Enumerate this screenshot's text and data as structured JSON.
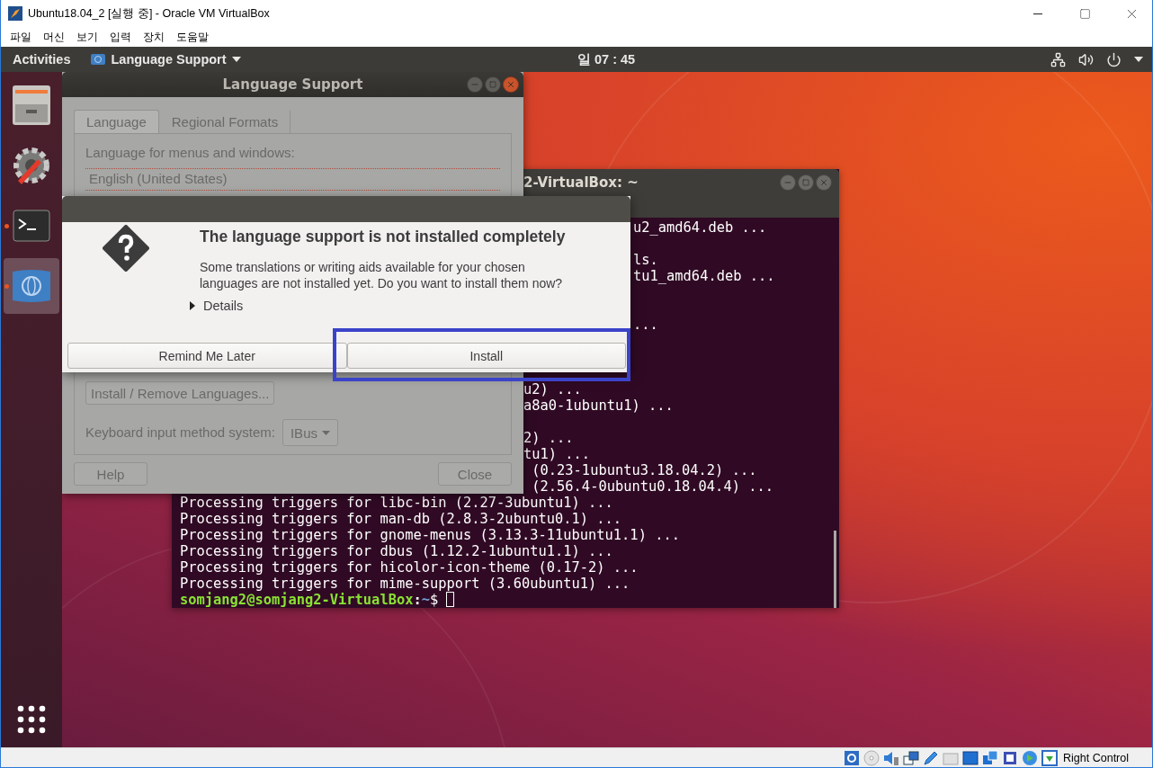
{
  "window": {
    "title": "Ubuntu18.04_2 [실행 중] - Oracle VM VirtualBox"
  },
  "menu": [
    "파일",
    "머신",
    "보기",
    "입력",
    "장치",
    "도움말"
  ],
  "top_bar": {
    "activities": "Activities",
    "app_menu": "Language Support",
    "clock": "일 07 : 45"
  },
  "dock": [
    {
      "kind": "files",
      "running": false,
      "selected": false
    },
    {
      "kind": "settings",
      "running": false,
      "selected": false
    },
    {
      "kind": "terminal",
      "running": true,
      "selected": false
    },
    {
      "kind": "language",
      "running": true,
      "selected": true
    }
  ],
  "terminal": {
    "title": "2-VirtualBox: ~",
    "lines": [
      {
        "kind": "past_dialog",
        "text": "u2_amd64.deb ..."
      },
      {
        "kind": "blank"
      },
      {
        "kind": "past_dialog",
        "text": "ls."
      },
      {
        "kind": "past_dialog",
        "text": "tu1_amd64.deb ..."
      },
      {
        "kind": "blank"
      },
      {
        "kind": "blank"
      },
      {
        "kind": "past_dialog",
        "text": "..."
      },
      {
        "kind": "blank"
      },
      {
        "kind": "blank"
      },
      {
        "kind": "blank"
      },
      {
        "kind": "past_window",
        "text": "u2) ..."
      },
      {
        "kind": "past_window",
        "text": "a8a0-1ubuntu1) ..."
      },
      {
        "kind": "blank"
      },
      {
        "kind": "past_window",
        "text": "2) ..."
      },
      {
        "kind": "past_window",
        "text": "tu1) ..."
      },
      {
        "kind": "past_window",
        "text": " (0.23-1ubuntu3.18.04.2) ..."
      },
      {
        "kind": "past_window",
        "text": " (2.56.4-0ubuntu0.18.04.4) ..."
      },
      {
        "kind": "full",
        "text": "Processing triggers for libc-bin (2.27-3ubuntu1) ..."
      },
      {
        "kind": "full",
        "text": "Processing triggers for man-db (2.8.3-2ubuntu0.1) ..."
      },
      {
        "kind": "full",
        "text": "Processing triggers for gnome-menus (3.13.3-11ubuntu1.1) ..."
      },
      {
        "kind": "full",
        "text": "Processing triggers for dbus (1.12.2-1ubuntu1.1) ..."
      },
      {
        "kind": "full",
        "text": "Processing triggers for hicolor-icon-theme (0.17-2) ..."
      },
      {
        "kind": "full",
        "text": "Processing triggers for mime-support (3.60ubuntu1) ..."
      }
    ],
    "prompt": {
      "user": "somjang2@somjang2-VirtualBox",
      "separator": ":",
      "path": "~",
      "symbol": "$"
    }
  },
  "language_support": {
    "title": "Language Support",
    "tabs": [
      {
        "label": "Language",
        "selected": true
      },
      {
        "label": "Regional Formats",
        "selected": false
      }
    ],
    "menus_label": "Language for menus and windows:",
    "languages": [
      "English (United States)"
    ],
    "install_remove": "Install / Remove Languages...",
    "input_label": "Keyboard input method system:",
    "input_method": "IBus",
    "help": "Help",
    "close": "Close"
  },
  "dialog": {
    "title": "The language support is not installed completely",
    "message": [
      "Some translations or writing aids available for your chosen",
      "languages are not installed yet. Do you want to install them now?"
    ],
    "details": "Details",
    "expanded": false,
    "buttons": [
      {
        "label": "Remind Me Later",
        "highlighted": false
      },
      {
        "label": "Install",
        "highlighted": true
      }
    ]
  },
  "status_bar": {
    "host_key": "Right Control"
  }
}
